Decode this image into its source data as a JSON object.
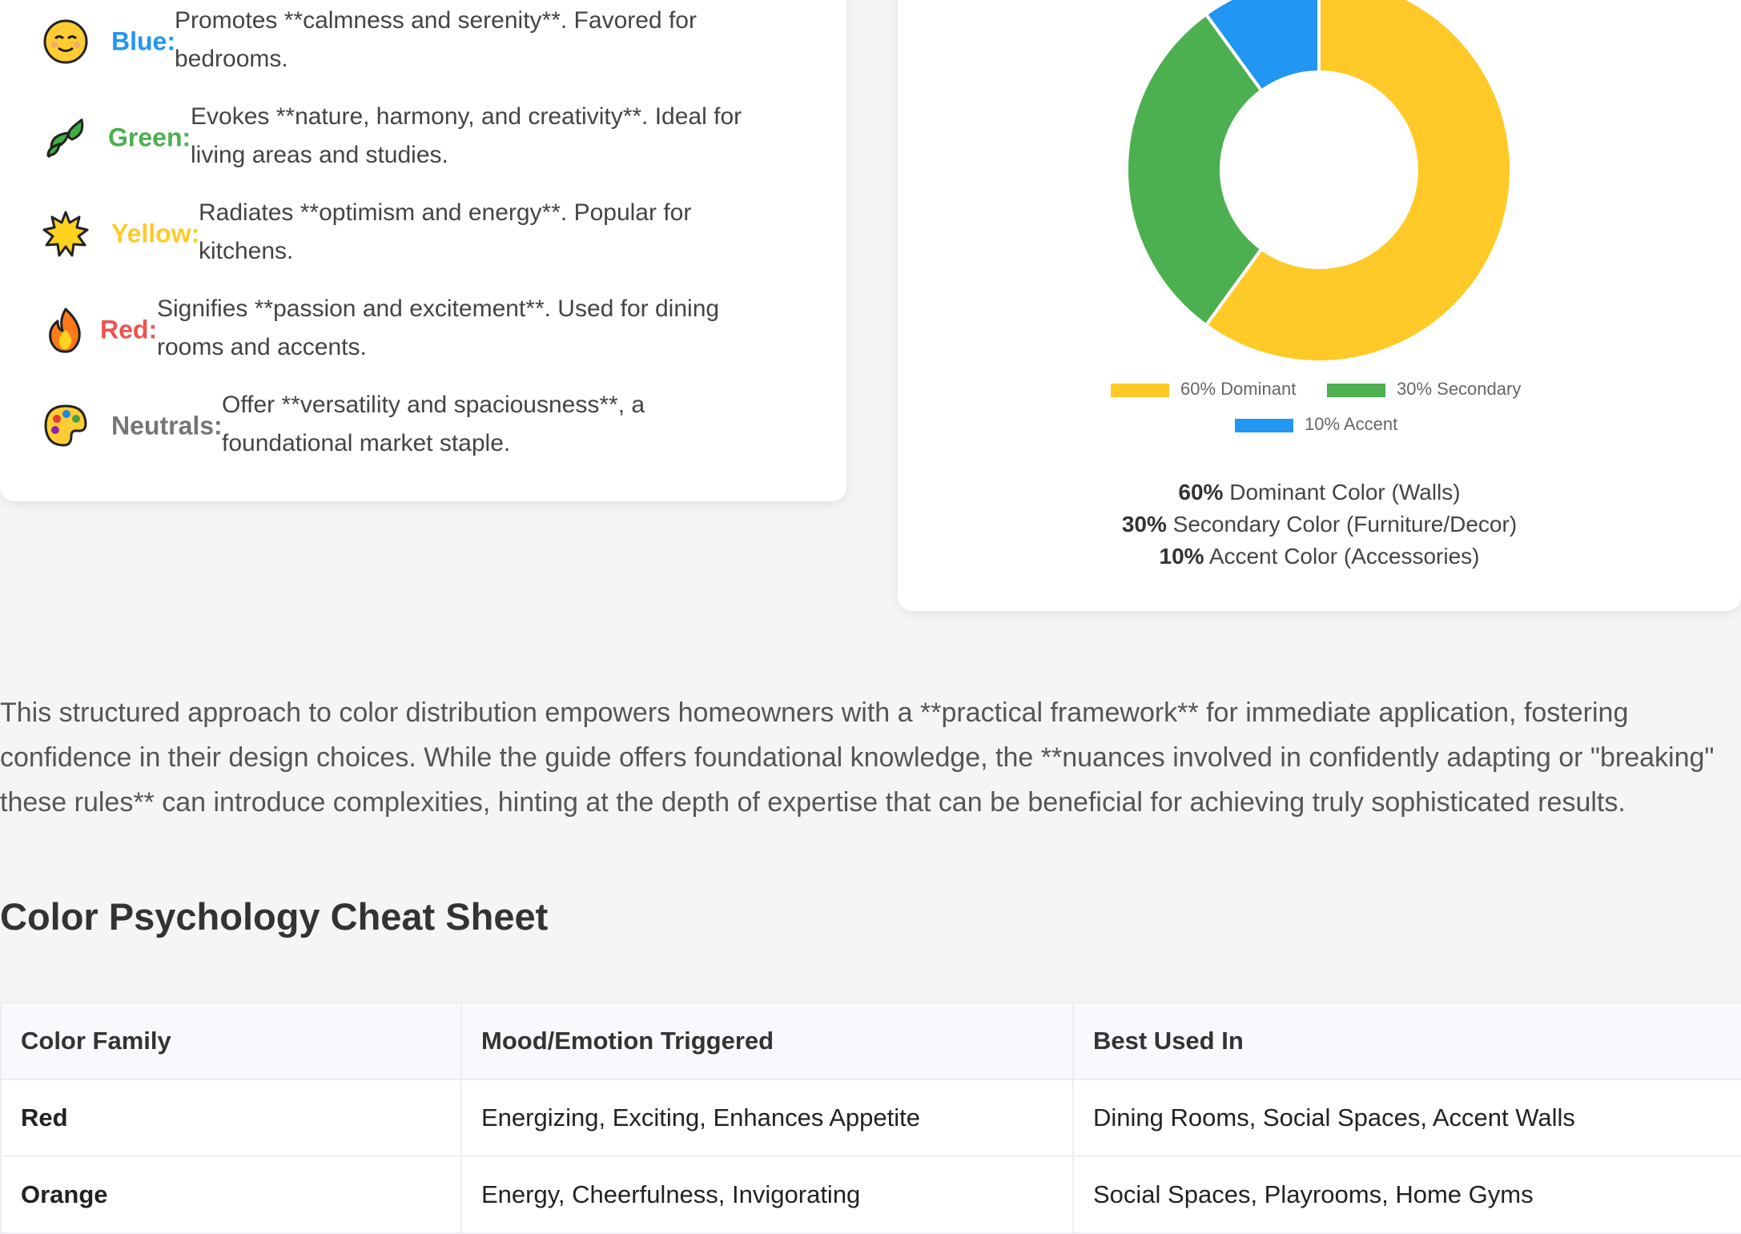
{
  "color_moods": [
    {
      "icon": "relieved-face-icon",
      "name": "Blue:",
      "color": "#2196f3",
      "description": "Promotes **calmness and serenity**. Favored for bedrooms."
    },
    {
      "icon": "leaf-icon",
      "name": "Green:",
      "color": "#4caf50",
      "description": "Evokes **nature, harmony, and creativity**. Ideal for living areas and studies."
    },
    {
      "icon": "sun-icon",
      "name": "Yellow:",
      "color": "#ffca28",
      "description": "Radiates **optimism and energy**. Popular for kitchens."
    },
    {
      "icon": "fire-icon",
      "name": "Red:",
      "color": "#ef5350",
      "description": "Signifies **passion and excitement**. Used for dining rooms and accents."
    },
    {
      "icon": "palette-icon",
      "name": "Neutrals:",
      "color": "#757575",
      "description": "Offer **versatility and spaciousness**, a foundational market staple."
    }
  ],
  "chart_data": {
    "type": "pie",
    "categories": [
      "60% Dominant",
      "30% Secondary",
      "10% Accent"
    ],
    "values": [
      60,
      30,
      10
    ],
    "colors": [
      "#ffca28",
      "#4caf50",
      "#2196f3"
    ],
    "legend_position": "bottom"
  },
  "ratio_notes": [
    {
      "percent": "60%",
      "text": " Dominant Color (Walls)"
    },
    {
      "percent": "30%",
      "text": " Secondary Color (Furniture/Decor)"
    },
    {
      "percent": "10%",
      "text": " Accent Color (Accessories)"
    }
  ],
  "summary": "This structured approach to color distribution empowers homeowners with a **practical framework** for immediate application, fostering confidence in their design choices. While the guide offers foundational knowledge, the **nuances involved in confidently adapting or \"breaking\" these rules** can introduce complexities, hinting at the depth of expertise that can be beneficial for achieving truly sophisticated results.",
  "cheat_sheet": {
    "title": "Color Psychology Cheat Sheet",
    "headers": [
      "Color Family",
      "Mood/Emotion Triggered",
      "Best Used In"
    ],
    "rows": [
      [
        "Red",
        "Energizing, Exciting, Enhances Appetite",
        "Dining Rooms, Social Spaces, Accent Walls"
      ],
      [
        "Orange",
        "Energy, Cheerfulness, Invigorating",
        "Social Spaces, Playrooms, Home Gyms"
      ]
    ]
  }
}
